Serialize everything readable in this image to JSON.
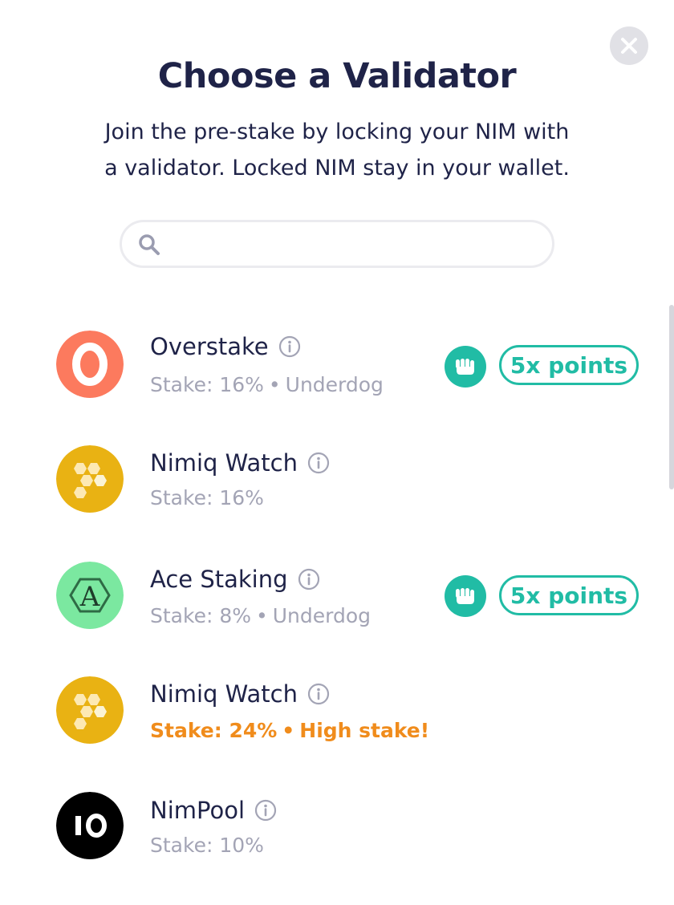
{
  "modal": {
    "title": "Choose a Validator",
    "subtitle_line1": "Join the pre-stake by locking your NIM with",
    "subtitle_line2": "a validator. Locked NIM stay in your wallet.",
    "close_icon": "close-icon"
  },
  "search": {
    "placeholder": "",
    "value": "",
    "icon": "search-icon"
  },
  "validators": [
    {
      "name": "Overstake",
      "stake": "Stake: 16%",
      "tag": "Underdog",
      "avatar": "overstake-logo",
      "avatar_letter": "O",
      "avatar_color": "#fc7a5e",
      "points": "5x points",
      "warning": false
    },
    {
      "name": "Nimiq Watch",
      "stake": "Stake: 16%",
      "tag": "",
      "avatar": "nimiq-watch-logo",
      "avatar_color": "#e9b213",
      "points": "",
      "warning": false
    },
    {
      "name": "Ace Staking",
      "stake": "Stake: 8%",
      "tag": "Underdog",
      "avatar": "ace-staking-logo",
      "avatar_letter": "A",
      "avatar_color": "#7be8a0",
      "points": "5x points",
      "warning": false
    },
    {
      "name": "Nimiq Watch",
      "stake": "Stake: 24%",
      "tag": "High stake!",
      "avatar": "nimiq-watch-logo",
      "avatar_color": "#e9b213",
      "points": "",
      "warning": true
    },
    {
      "name": "NimPool",
      "stake": "Stake: 10%",
      "tag": "",
      "avatar": "nimpool-logo",
      "avatar_letter": "IO",
      "avatar_color": "#000000",
      "points": "",
      "warning": false
    }
  ],
  "colors": {
    "title": "#1f2348",
    "muted": "#a3a4b5",
    "teal": "#21bca5",
    "warning": "#f08c1c"
  }
}
